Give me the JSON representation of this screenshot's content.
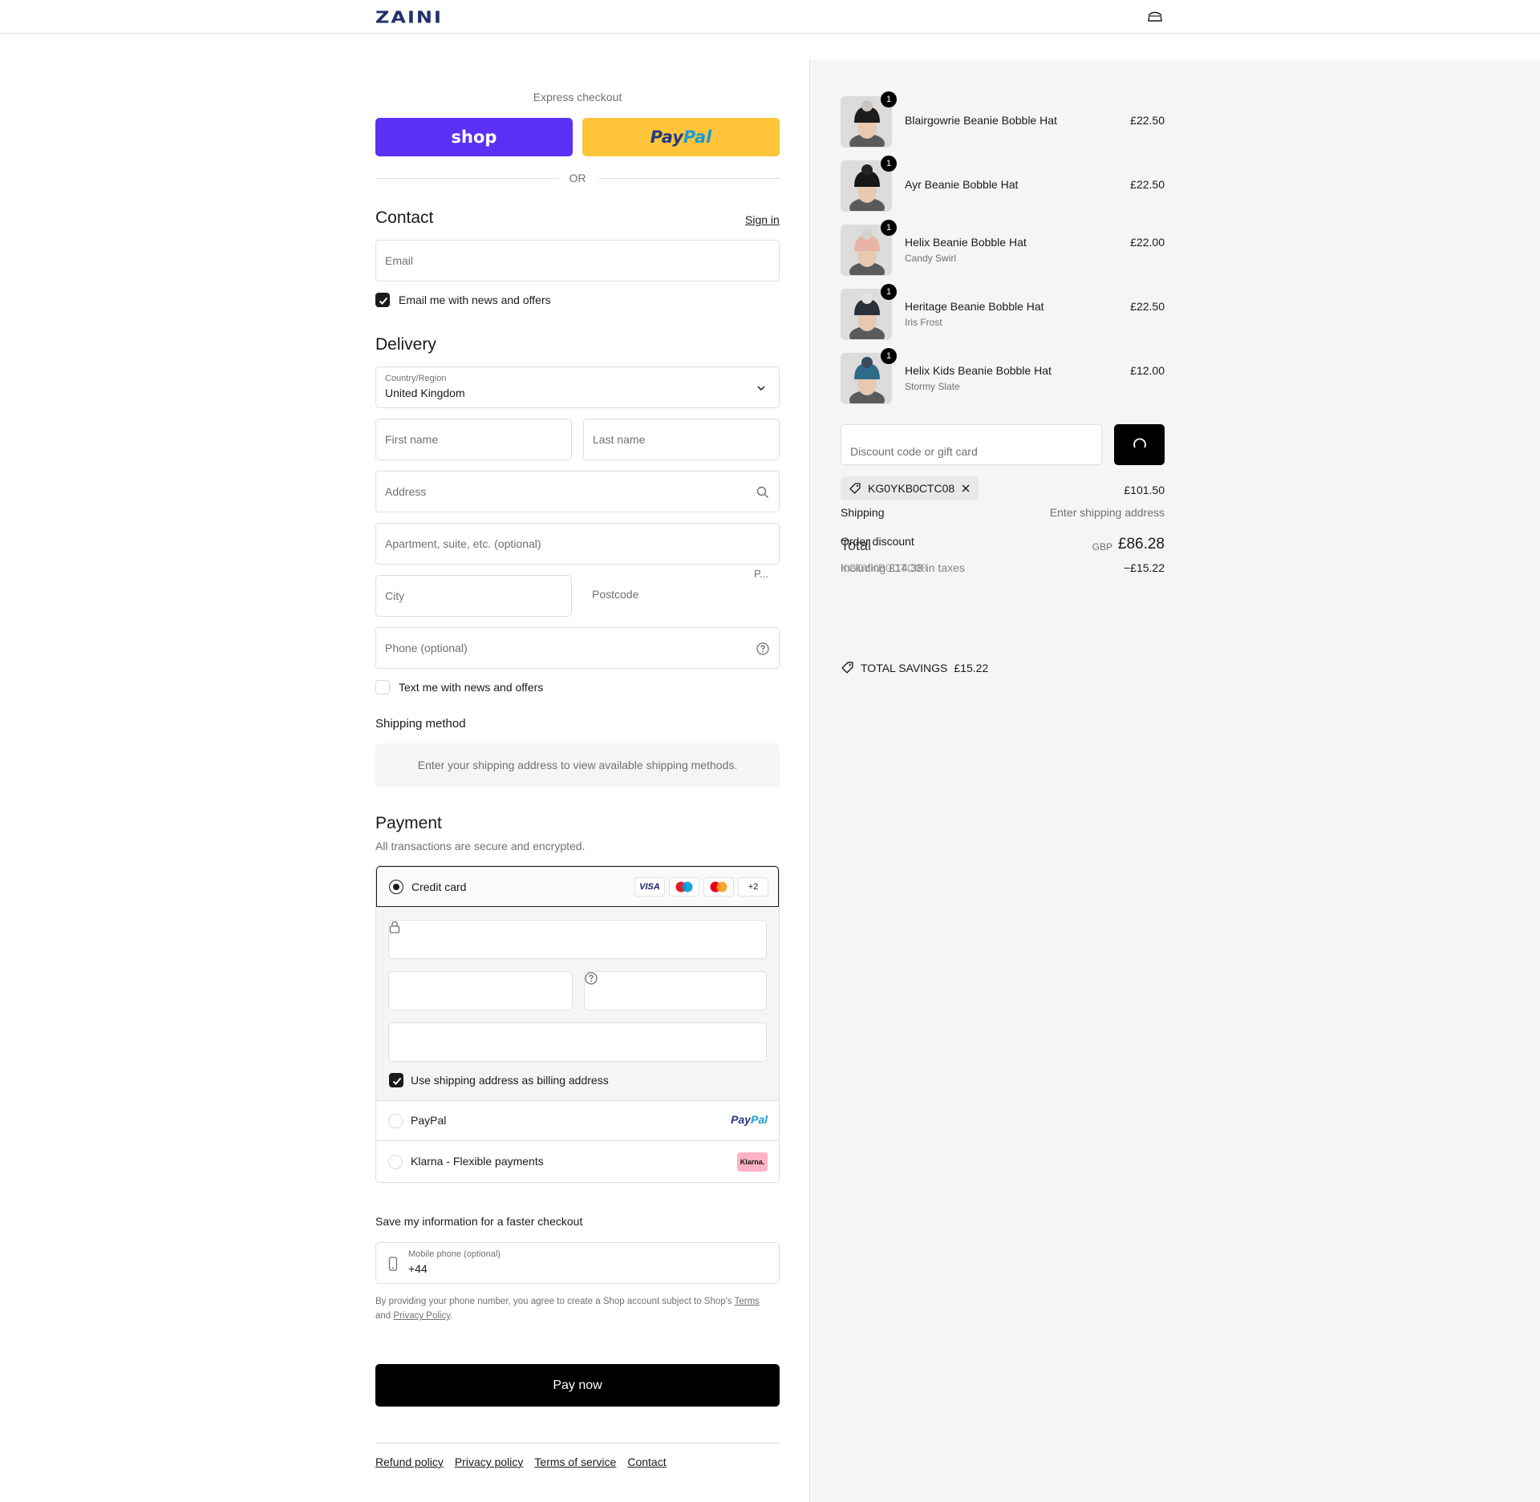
{
  "header": {
    "logo": "ZAINI",
    "cart_icon": "bag-icon"
  },
  "express": {
    "title": "Express checkout",
    "shop_label": "shop",
    "paypal_part1": "Pay",
    "paypal_part2": "Pal",
    "or_label": "OR"
  },
  "contact": {
    "title": "Contact",
    "sign_in": "Sign in",
    "email_placeholder": "Email",
    "email_news_label": "Email me with news and offers",
    "email_news_checked": true
  },
  "delivery": {
    "title": "Delivery",
    "country_label": "Country/Region",
    "country_value": "United Kingdom",
    "first_name_placeholder": "First name",
    "last_name_placeholder": "Last name",
    "address_placeholder": "Address",
    "apartment_placeholder": "Apartment, suite, etc. (optional)",
    "truncated_hint": "P...",
    "city_placeholder": "City",
    "postcode_placeholder": "Postcode",
    "phone_placeholder": "Phone (optional)",
    "text_news_label": "Text me with news and offers",
    "text_news_checked": false
  },
  "shipping_method": {
    "title": "Shipping method",
    "message": "Enter your shipping address to view available shipping methods."
  },
  "payment": {
    "title": "Payment",
    "subtitle": "All transactions are secure and encrypted.",
    "credit_card_label": "Credit card",
    "card_brands": [
      "VISA",
      "+2"
    ],
    "billing_same_label": "Use shipping address as billing address",
    "billing_same_checked": true,
    "paypal_label": "PayPal",
    "paypal_logo_part1": "Pay",
    "paypal_logo_part2": "Pal",
    "klarna_label": "Klarna - Flexible payments",
    "klarna_logo": "Klarna."
  },
  "save_info": {
    "title": "Save my information for a faster checkout",
    "mobile_label": "Mobile phone (optional)",
    "mobile_value": "+44",
    "legal_prefix": "By providing your phone number, you agree to create a Shop account subject to Shop's",
    "legal_terms": "Terms",
    "legal_and": "and",
    "legal_privacy": "Privacy Policy",
    "legal_suffix": "."
  },
  "pay_now": "Pay now",
  "footer": {
    "links": [
      "Refund policy",
      "Privacy policy",
      "Terms of service",
      "Contact"
    ]
  },
  "order": {
    "items": [
      {
        "name": "Blairgowrie Beanie Bobble Hat",
        "variant": "",
        "price": "£22.50",
        "qty": "1",
        "hat_color": "#1c1c1c",
        "bobble_color": "#c9c4c0"
      },
      {
        "name": "Ayr Beanie Bobble Hat",
        "variant": "",
        "price": "£22.50",
        "qty": "1",
        "hat_color": "#161616",
        "bobble_color": "#222222"
      },
      {
        "name": "Helix Beanie Bobble Hat",
        "variant": "Candy Swirl",
        "price": "£22.00",
        "qty": "1",
        "hat_color": "#e7b4a5",
        "bobble_color": "#d8d2cc"
      },
      {
        "name": "Heritage Beanie Bobble Hat",
        "variant": "Iris Frost",
        "price": "£22.50",
        "qty": "1",
        "hat_color": "#2b2f3a",
        "bobble_color": "#e3e3e3"
      },
      {
        "name": "Helix Kids Beanie Bobble Hat",
        "variant": "Stormy Slate",
        "price": "£12.00",
        "qty": "1",
        "hat_color": "#2f6a8a",
        "bobble_color": "#3c4b5a"
      }
    ],
    "discount_placeholder": "Discount code or gift card",
    "applied_code": "KG0YKB0CTC08",
    "subtotal": "£101.50",
    "shipping_label": "Shipping",
    "shipping_value": "Enter shipping address",
    "order_discount_label": "Order discount",
    "total_label": "Total",
    "order_discount_code": "KG0YKB0CTC08",
    "including_taxes": "Including £14.38 in taxes",
    "currency": "GBP",
    "total_value": "£86.28",
    "discount_value": "−£15.22",
    "total_savings_label": "TOTAL SAVINGS",
    "total_savings_value": "£15.22"
  },
  "colors": {
    "shop_purple": "#5a31f4",
    "paypal_yellow": "#ffc439",
    "logo_navy": "#22306b",
    "klarna_pink": "#ffb3c7"
  }
}
